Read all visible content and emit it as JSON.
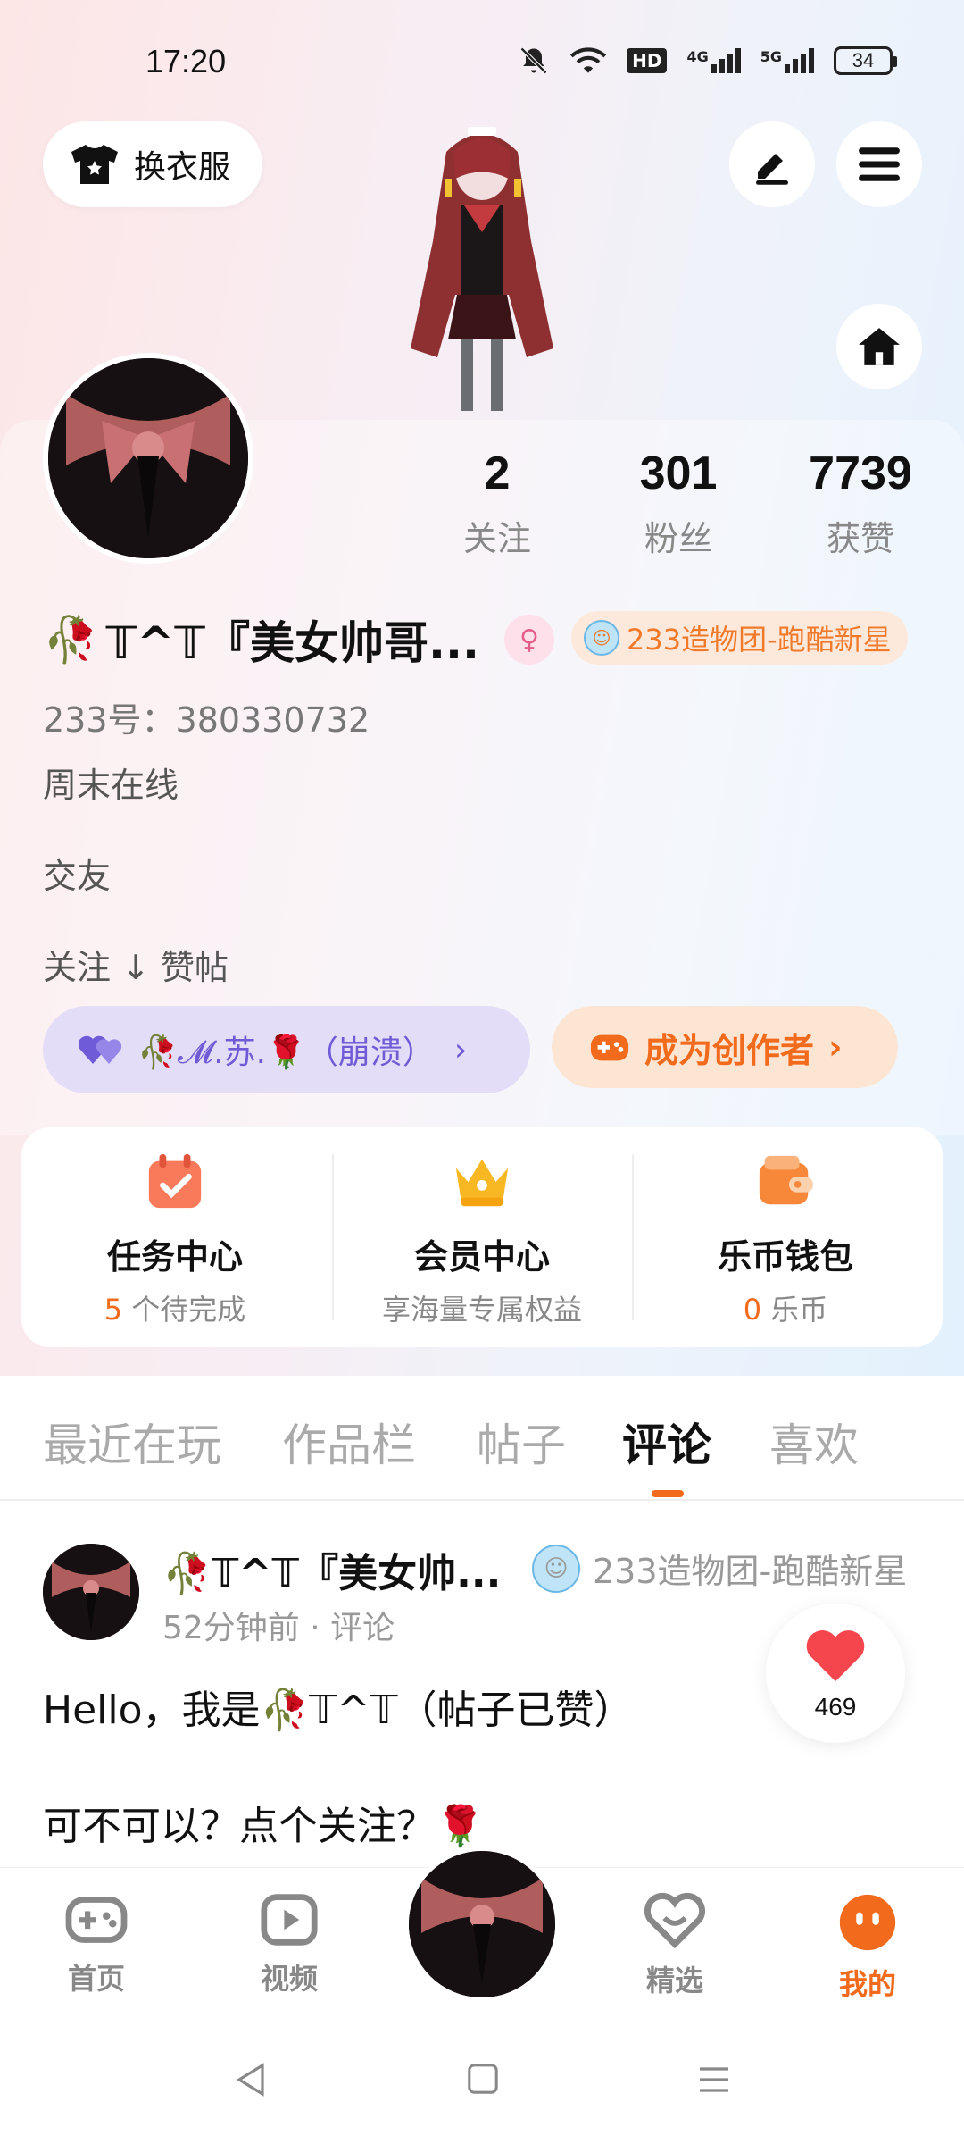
{
  "status_bar": {
    "time": "17:20",
    "network_hd": "HD",
    "signal_4g": "4G",
    "signal_5g": "5G",
    "battery": "34"
  },
  "header": {
    "outfit_button": "换衣服"
  },
  "stats": [
    {
      "value": "2",
      "label": "关注"
    },
    {
      "value": "301",
      "label": "粉丝"
    },
    {
      "value": "7739",
      "label": "获赞"
    }
  ],
  "profile": {
    "name_prefix": "🥀",
    "name": "𝕋^𝕋『美女帅哥...",
    "title_badge": "233造物团-跑酷新星",
    "id_line": "233号：380330732",
    "bio": [
      "周末在线",
      "交友",
      "关注 ↓ 赞帖"
    ],
    "bond_pill": "🥀𝓜.苏.🌹（崩溃）",
    "creator_pill": "成为创作者"
  },
  "services": [
    {
      "name": "任务中心",
      "sub_highlight": "5",
      "sub": " 个待完成"
    },
    {
      "name": "会员中心",
      "sub_highlight": "",
      "sub": "享海量专属权益"
    },
    {
      "name": "乐币钱包",
      "sub_highlight": "0",
      "sub": " 乐币"
    }
  ],
  "tabs": [
    "最近在玩",
    "作品栏",
    "帖子",
    "评论",
    "喜欢"
  ],
  "active_tab": "评论",
  "comment": {
    "author": "🥀𝕋^𝕋『美女帅...",
    "badge": "233造物团-跑酷新星",
    "meta": "52分钟前 · 评论",
    "line1": "Hello，我是🥀𝕋^𝕋（帖子已赞）",
    "line2": "可不可以？点个关注？🌹",
    "likes": "469"
  },
  "bottom_nav": [
    {
      "label": "首页",
      "icon": "gamepad-icon"
    },
    {
      "label": "视频",
      "icon": "video-icon"
    },
    {
      "label": "精选",
      "icon": "heart-chat-icon"
    },
    {
      "label": "我的",
      "icon": "smile-face-icon"
    }
  ],
  "colors": {
    "accent": "#f26a1b",
    "bond": "#6f5bd6",
    "hero_left": "#fde6e6",
    "hero_right": "#e2f1fd"
  }
}
